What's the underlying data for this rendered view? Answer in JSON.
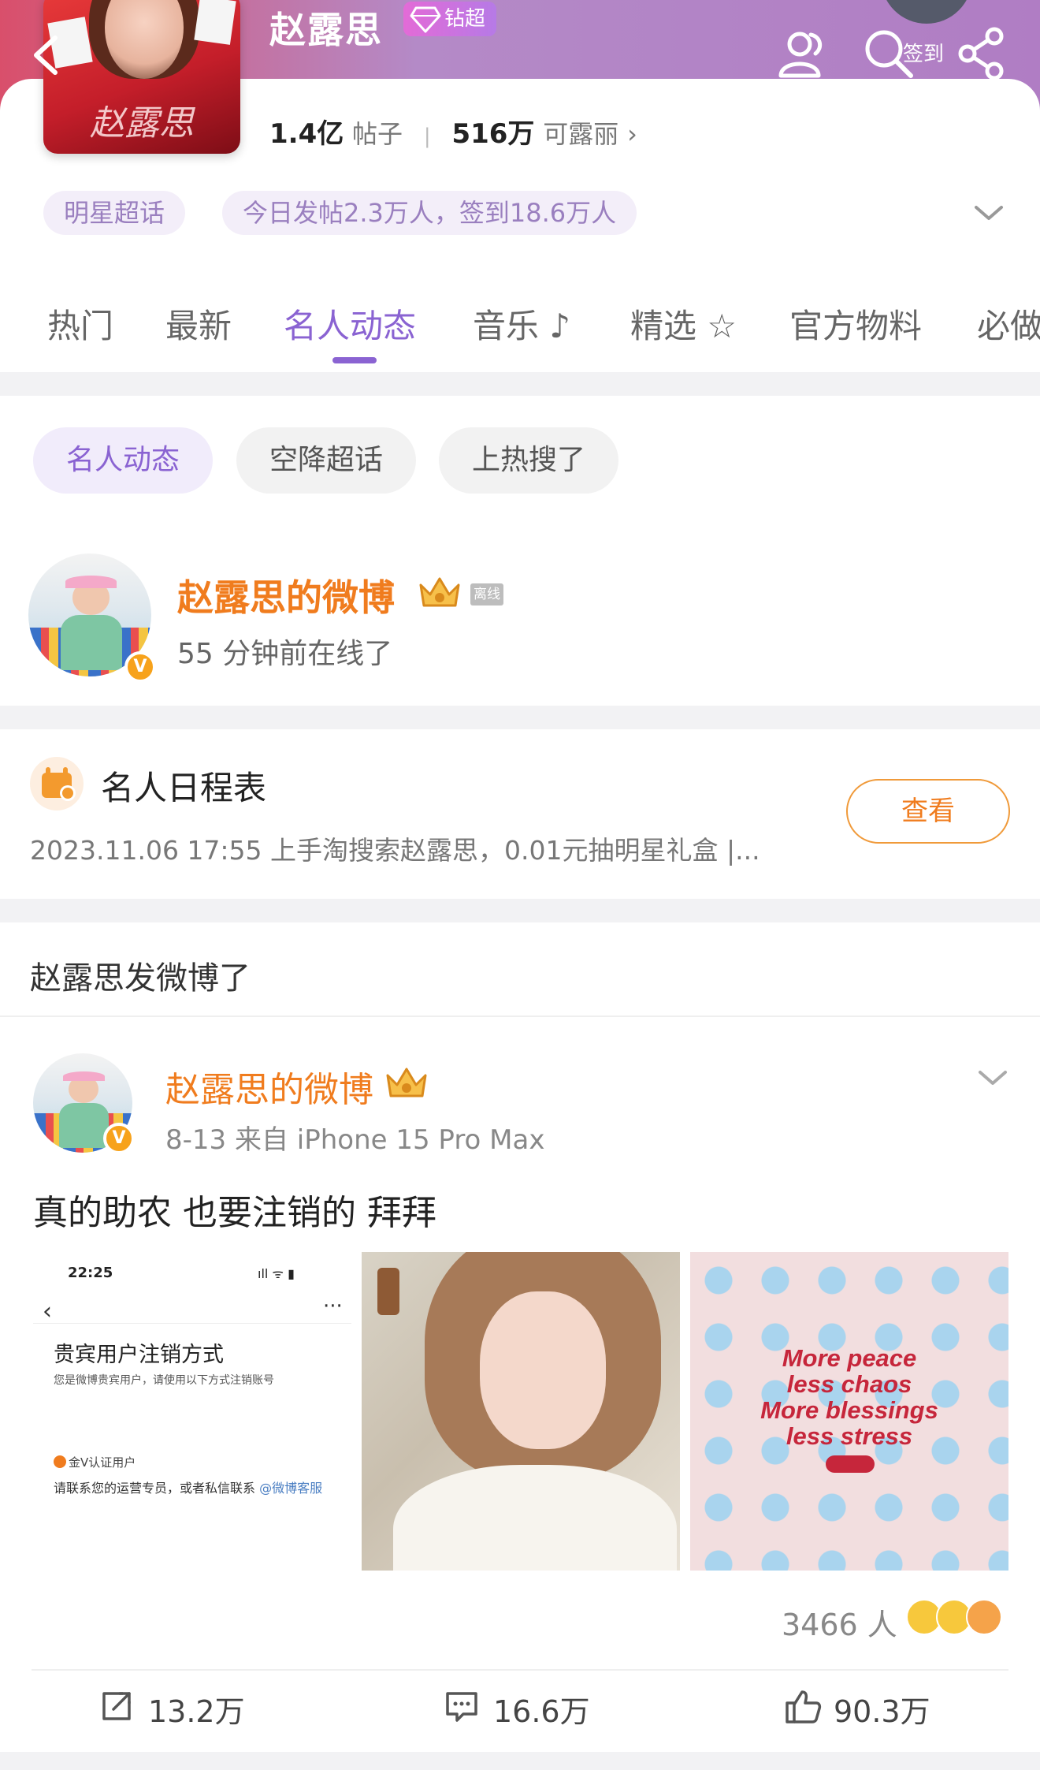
{
  "header": {
    "title": "赵露思",
    "badge_label": "钻超",
    "signin_label": "签到",
    "cover_text": "赵露思",
    "posts_count": "1.4亿",
    "posts_label": "帖子",
    "fans_count": "516万",
    "fans_label": "可露丽",
    "fans_chevron": "›",
    "chip_topic": "明星超话",
    "chip_stats": "今日发帖2.3万人，签到18.6万人",
    "gradient_colors": [
      "#d94f6b",
      "#b48ac7"
    ]
  },
  "tabs": [
    {
      "label": "热门"
    },
    {
      "label": "最新"
    },
    {
      "label": "名人动态"
    },
    {
      "label": "音乐"
    },
    {
      "label": "精选"
    },
    {
      "label": "官方物料"
    },
    {
      "label": "必做"
    }
  ],
  "active_tab": "名人动态",
  "accent_color": "#8a63d2",
  "subchips": [
    {
      "label": "名人动态",
      "active": true
    },
    {
      "label": "空降超话",
      "active": false
    },
    {
      "label": "上热搜了",
      "active": false
    }
  ],
  "celebrity": {
    "name": "赵露思的微博",
    "status_tag": "离线",
    "online_text": "55 分钟前在线了",
    "verified": "V"
  },
  "schedule": {
    "title": "名人日程表",
    "text": "2023.11.06 17:55 上手淘搜索赵露思，0.01元抽明星礼盒 |...",
    "view_button": "查看"
  },
  "section_title": "赵露思发微博了",
  "post": {
    "author": "赵露思的微博",
    "meta": "8-13  来自 iPhone 15 Pro Max",
    "text": "真的助农 也要注销的 拜拜",
    "photo1": {
      "time": "22:25",
      "status": "ıll ᯤ ▮",
      "back": "‹",
      "more": "···",
      "heading": "贵宾用户注销方式",
      "subheading": "您是微博贵宾用户，请使用以下方式注销账号",
      "gold_label": "金V认证用户",
      "contact": "请联系您的运营专员，或者私信联系 ",
      "contact_link": "@微博客服"
    },
    "photo3_lines": [
      "More peace",
      "less chaos",
      "More blessings",
      "less stress"
    ],
    "reactions_count": "3466 人",
    "reposts": "13.2万",
    "comments": "16.6万",
    "likes": "90.3万"
  }
}
